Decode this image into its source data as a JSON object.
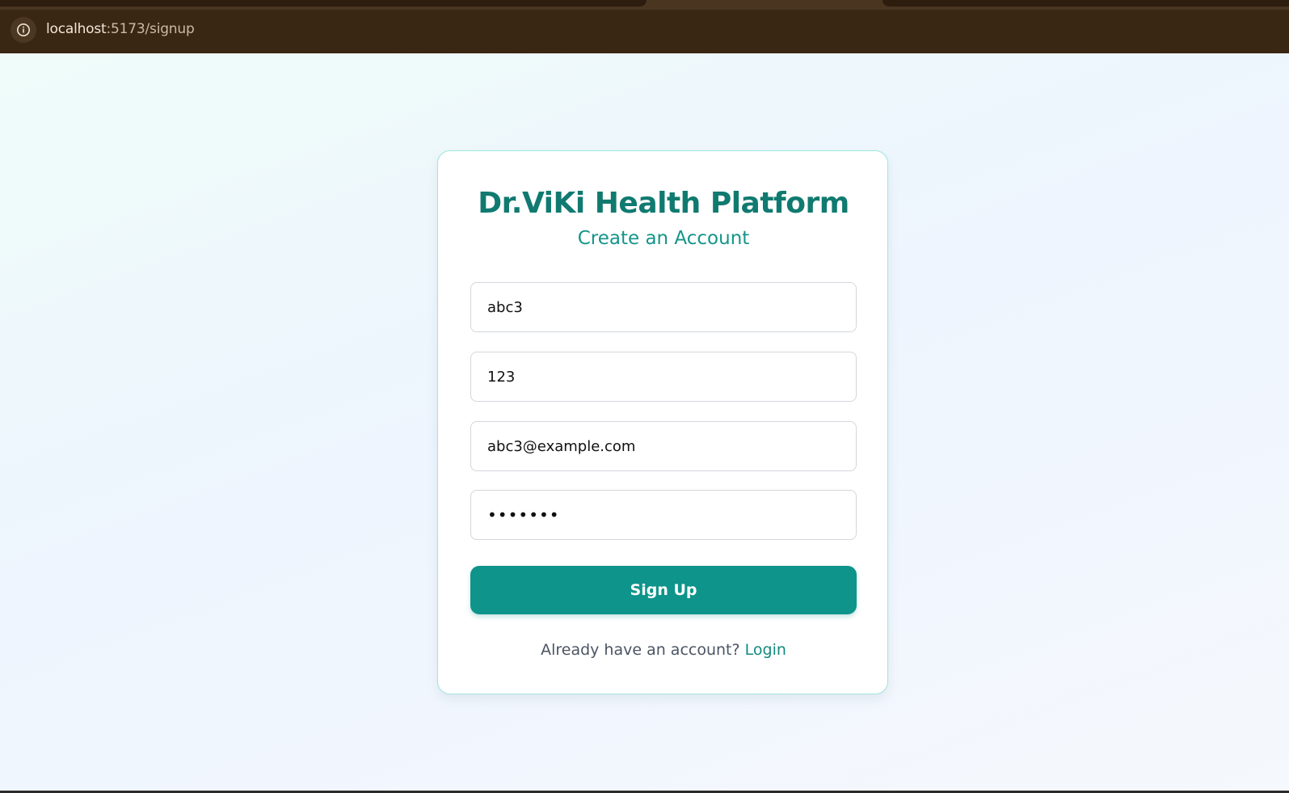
{
  "browser": {
    "url_host": "localhost",
    "url_path": ":5173/signup"
  },
  "card": {
    "title": "Dr.ViKi Health Platform",
    "subtitle": "Create an Account",
    "fields": [
      {
        "value": "abc3"
      },
      {
        "value": "123"
      },
      {
        "value": "abc3@example.com"
      },
      {
        "value": "•••••••"
      }
    ],
    "submit_label": "Sign Up",
    "login_prompt": "Already have an account?",
    "login_link": "Login"
  },
  "colors": {
    "brand": "#107a70",
    "accent": "#0e948a",
    "card_border": "#9fe7dc"
  },
  "icons": {
    "site_info": "info-circle-icon"
  }
}
